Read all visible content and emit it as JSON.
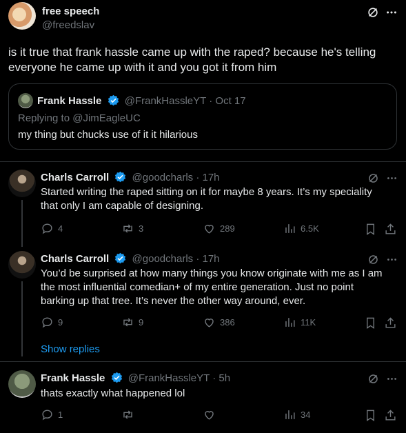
{
  "main_post": {
    "name": "free speech",
    "handle": "@freedslav",
    "text_line1": "is it true that frank hassle came up with the raped?  because he's telling",
    "text_line2": "everyone he came up with it and you got it from him"
  },
  "quote": {
    "name": "Frank Hassle",
    "handle": "@FrankHassleYT",
    "sep": "·",
    "time": "Oct 17",
    "reply_prefix": "Replying to ",
    "reply_to": "@JimEagleUC",
    "text": "my thing but chucks use of it it hilarious"
  },
  "reply1": {
    "name": "Charls Carroll",
    "handle": "@goodcharls",
    "sep": "·",
    "time": "17h",
    "line1": "Started writing the raped sitting on it for maybe 8 years. It’s my speciality",
    "line2": "that only I am capable of designing.",
    "replies": "4",
    "reposts": "3",
    "likes": "289",
    "views": "6.5K"
  },
  "reply2": {
    "name": "Charls Carroll",
    "handle": "@goodcharls",
    "sep": "·",
    "time": "17h",
    "line1": "You’d be surprised at how many things you know originate with me as I am",
    "line2": "the most influential comedian+ of my entire generation.  Just no point",
    "line3": "barking up that tree. It’s never the other way around, ever.",
    "replies": "9",
    "reposts": "9",
    "likes": "386",
    "views": "11K"
  },
  "show_replies": "Show replies",
  "reply3": {
    "name": "Frank Hassle",
    "handle": "@FrankHassleYT",
    "sep": "·",
    "time": "5h",
    "text": "thats exactly what happened lol",
    "replies": "1",
    "views": "34"
  },
  "colors": {
    "background": "#000000",
    "text": "#e7e9ea",
    "muted": "#71767b",
    "accent": "#1d9bf0",
    "border": "#2f3336"
  },
  "icons": [
    "grok-icon",
    "more-icon",
    "verified-icon",
    "reply-icon",
    "repost-icon",
    "like-icon",
    "views-icon",
    "bookmark-icon",
    "share-icon"
  ]
}
